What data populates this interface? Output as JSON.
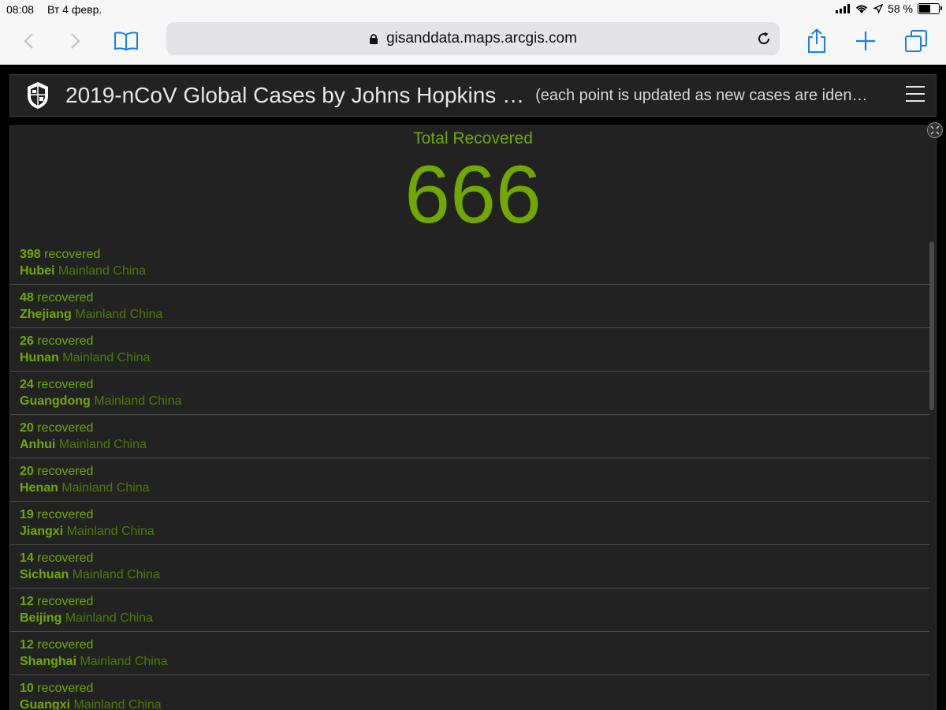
{
  "status_bar": {
    "time": "08:08",
    "date": "Вт 4 февр.",
    "battery": "58 %",
    "battery_level": 0.58
  },
  "safari": {
    "url": "gisanddata.maps.arcgis.com",
    "accent_color": "#1a7cf5"
  },
  "dashboard": {
    "title": "2019-nCoV Global Cases by Johns Hopkins …",
    "subtitle": "(each point is updated as new cases are iden…",
    "panel": {
      "heading": "Total Recovered",
      "total": "666",
      "accent_color": "#70a800",
      "rows": [
        {
          "count": "398",
          "label": "recovered",
          "region": "Hubei",
          "country": "Mainland China"
        },
        {
          "count": "48",
          "label": "recovered",
          "region": "Zhejiang",
          "country": "Mainland China"
        },
        {
          "count": "26",
          "label": "recovered",
          "region": "Hunan",
          "country": "Mainland China"
        },
        {
          "count": "24",
          "label": "recovered",
          "region": "Guangdong",
          "country": "Mainland China"
        },
        {
          "count": "20",
          "label": "recovered",
          "region": "Anhui",
          "country": "Mainland China"
        },
        {
          "count": "20",
          "label": "recovered",
          "region": "Henan",
          "country": "Mainland China"
        },
        {
          "count": "19",
          "label": "recovered",
          "region": "Jiangxi",
          "country": "Mainland China"
        },
        {
          "count": "14",
          "label": "recovered",
          "region": "Sichuan",
          "country": "Mainland China"
        },
        {
          "count": "12",
          "label": "recovered",
          "region": "Beijing",
          "country": "Mainland China"
        },
        {
          "count": "12",
          "label": "recovered",
          "region": "Shanghai",
          "country": "Mainland China"
        },
        {
          "count": "10",
          "label": "recovered",
          "region": "Guangxi",
          "country": "Mainland China"
        }
      ]
    }
  }
}
